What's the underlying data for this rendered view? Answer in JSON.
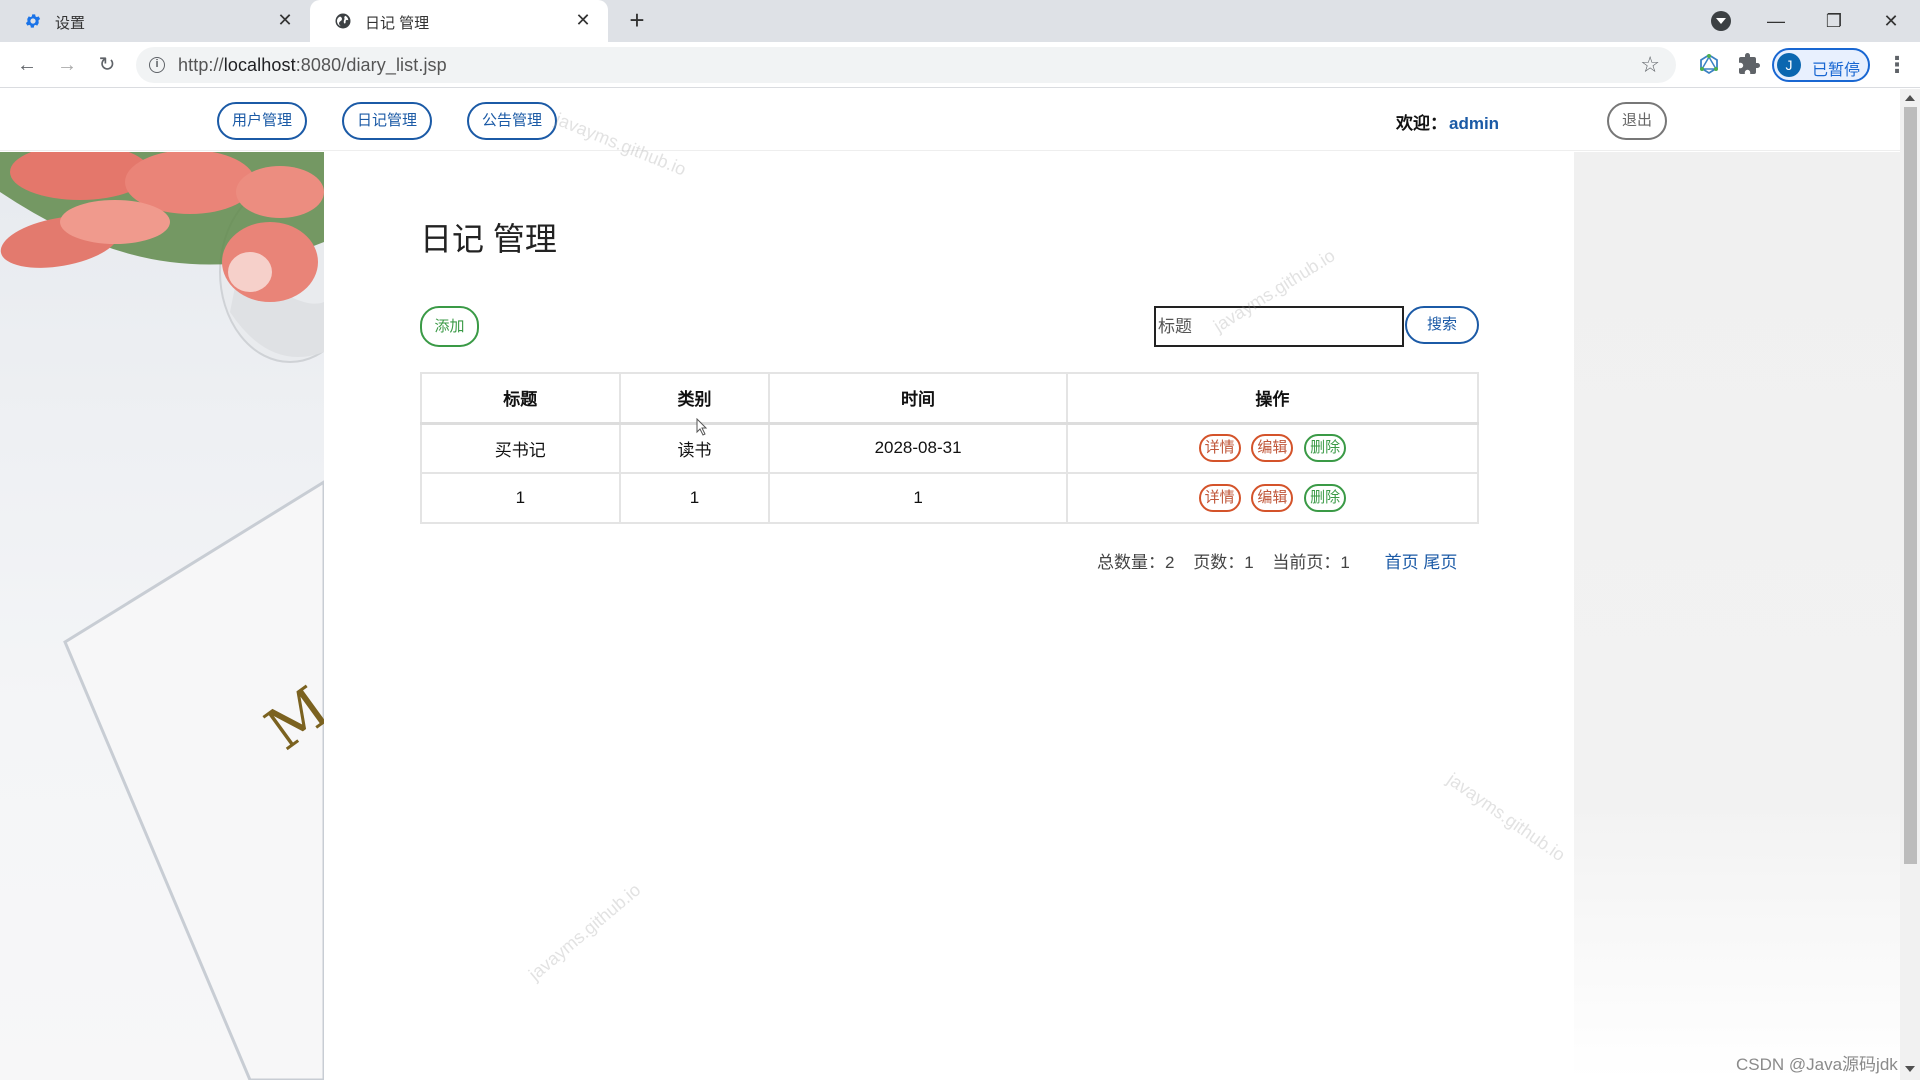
{
  "browser": {
    "tabs": [
      {
        "title": "设置",
        "icon": "gear-icon",
        "active": false
      },
      {
        "title": "日记 管理",
        "icon": "globe-icon",
        "active": true
      }
    ],
    "url_prefix": "http://",
    "url_host": "localhost",
    "url_rest": ":8080/diary_list.jsp",
    "profile_initial": "J",
    "profile_status": "已暂停"
  },
  "nav": {
    "items": [
      {
        "label": "用户管理"
      },
      {
        "label": "日记管理"
      },
      {
        "label": "公告管理"
      }
    ],
    "welcome_label": "欢迎：",
    "username": "admin",
    "logout_label": "退出"
  },
  "main": {
    "title": "日记 管理",
    "add_label": "添加",
    "search_placeholder": "标题",
    "search_label": "搜索",
    "table": {
      "columns": [
        "标题",
        "类别",
        "时间",
        "操作"
      ],
      "rows": [
        {
          "title": "买书记",
          "category": "读书",
          "time": "2028-08-31"
        },
        {
          "title": "1",
          "category": "1",
          "time": "1"
        }
      ],
      "actions": {
        "detail": "详情",
        "edit": "编辑",
        "delete": "删除"
      }
    },
    "pager": {
      "total_label": "总数量：",
      "total": "2",
      "pages_label": "页数：",
      "pages": "1",
      "current_label": "当前页：",
      "current": "1",
      "first_label": "首页",
      "last_label": "尾页"
    }
  },
  "watermark": "javayms.github.io",
  "footer_credit": "CSDN @Java源码jdk",
  "colors": {
    "primary_blue": "#1b5aa6",
    "success_green": "#3a9a46",
    "danger_orange": "#d4532a"
  }
}
